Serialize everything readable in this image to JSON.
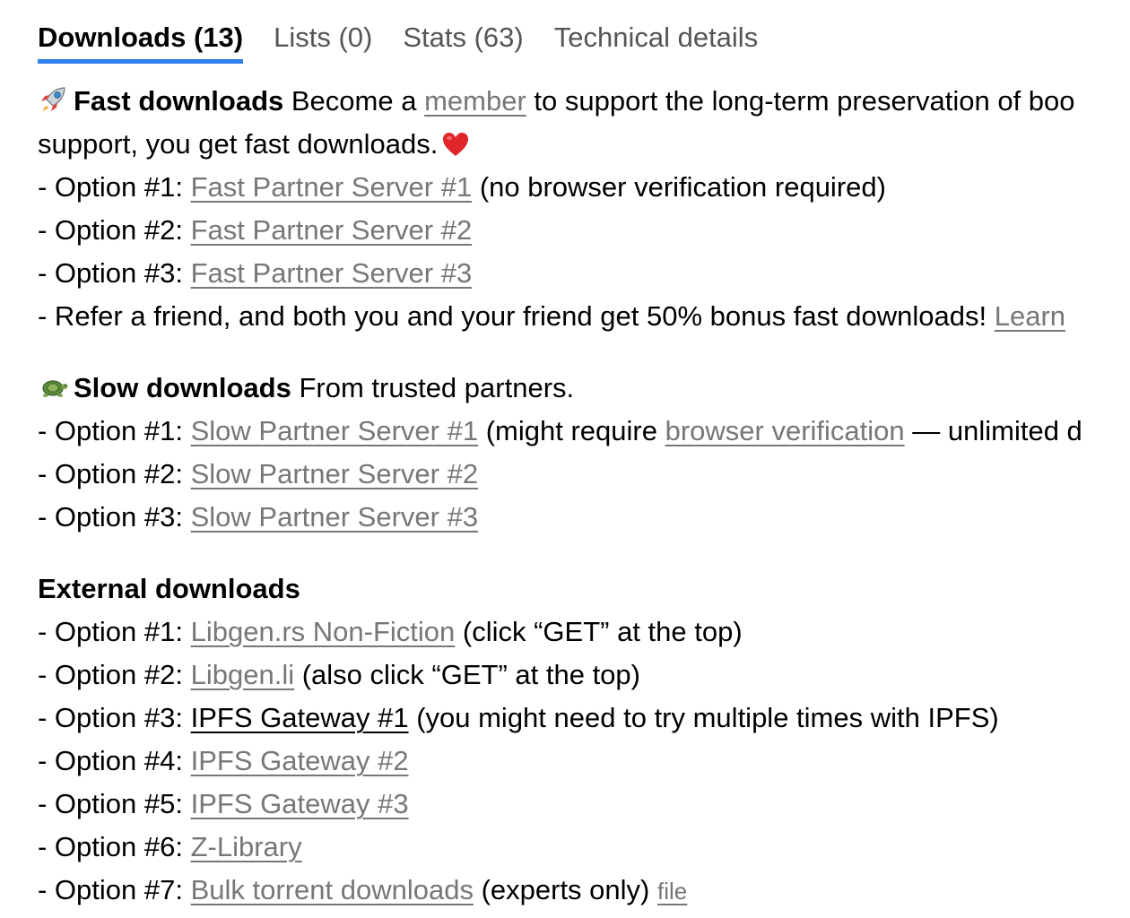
{
  "tabs": [
    {
      "label": "Downloads (13)",
      "active": true
    },
    {
      "label": "Lists (0)",
      "active": false
    },
    {
      "label": "Stats (63)",
      "active": false
    },
    {
      "label": "Technical details",
      "active": false
    }
  ],
  "fast": {
    "icon": "rocket-icon",
    "title": "Fast downloads",
    "intro_before": "Become a",
    "member_link": "member",
    "intro_after": "to support the long-term preservation of boo",
    "intro_line2": "support, you get fast downloads.",
    "heart_icon": "heart-icon",
    "options": [
      {
        "prefix": "- Option #1:",
        "link": "Fast Partner Server #1",
        "suffix": "(no browser verification required)"
      },
      {
        "prefix": "- Option #2:",
        "link": "Fast Partner Server #2",
        "suffix": ""
      },
      {
        "prefix": "- Option #3:",
        "link": "Fast Partner Server #3",
        "suffix": ""
      }
    ],
    "refer_text": "- Refer a friend, and both you and your friend get 50% bonus fast downloads!",
    "refer_link": "Learn"
  },
  "slow": {
    "icon": "turtle-icon",
    "title": "Slow downloads",
    "intro": "From trusted partners.",
    "options": [
      {
        "prefix": "- Option #1:",
        "link": "Slow Partner Server #1",
        "suffix_before": "(might require",
        "extra_link": "browser verification",
        "suffix_after": "— unlimited d"
      },
      {
        "prefix": "- Option #2:",
        "link": "Slow Partner Server #2"
      },
      {
        "prefix": "- Option #3:",
        "link": "Slow Partner Server #3"
      }
    ]
  },
  "external": {
    "title": "External downloads",
    "options": [
      {
        "prefix": "- Option #1:",
        "link": "Libgen.rs Non-Fiction",
        "suffix": "(click “GET” at the top)"
      },
      {
        "prefix": "- Option #2:",
        "link": "Libgen.li",
        "suffix": "(also click “GET” at the top)"
      },
      {
        "prefix": "- Option #3:",
        "link": "IPFS Gateway #1",
        "suffix": "(you might need to try multiple times with IPFS)"
      },
      {
        "prefix": "- Option #4:",
        "link": "IPFS Gateway #2",
        "suffix": ""
      },
      {
        "prefix": "- Option #5:",
        "link": "IPFS Gateway #3",
        "suffix": ""
      },
      {
        "prefix": "- Option #6:",
        "link": "Z-Library",
        "suffix": ""
      },
      {
        "prefix": "- Option #7:",
        "link": "Bulk torrent downloads",
        "suffix": "(experts only)",
        "small_link": "file"
      }
    ]
  },
  "colors": {
    "tab_underline": "#2f80ed",
    "link": "#777777",
    "heart": "#e0262b"
  }
}
